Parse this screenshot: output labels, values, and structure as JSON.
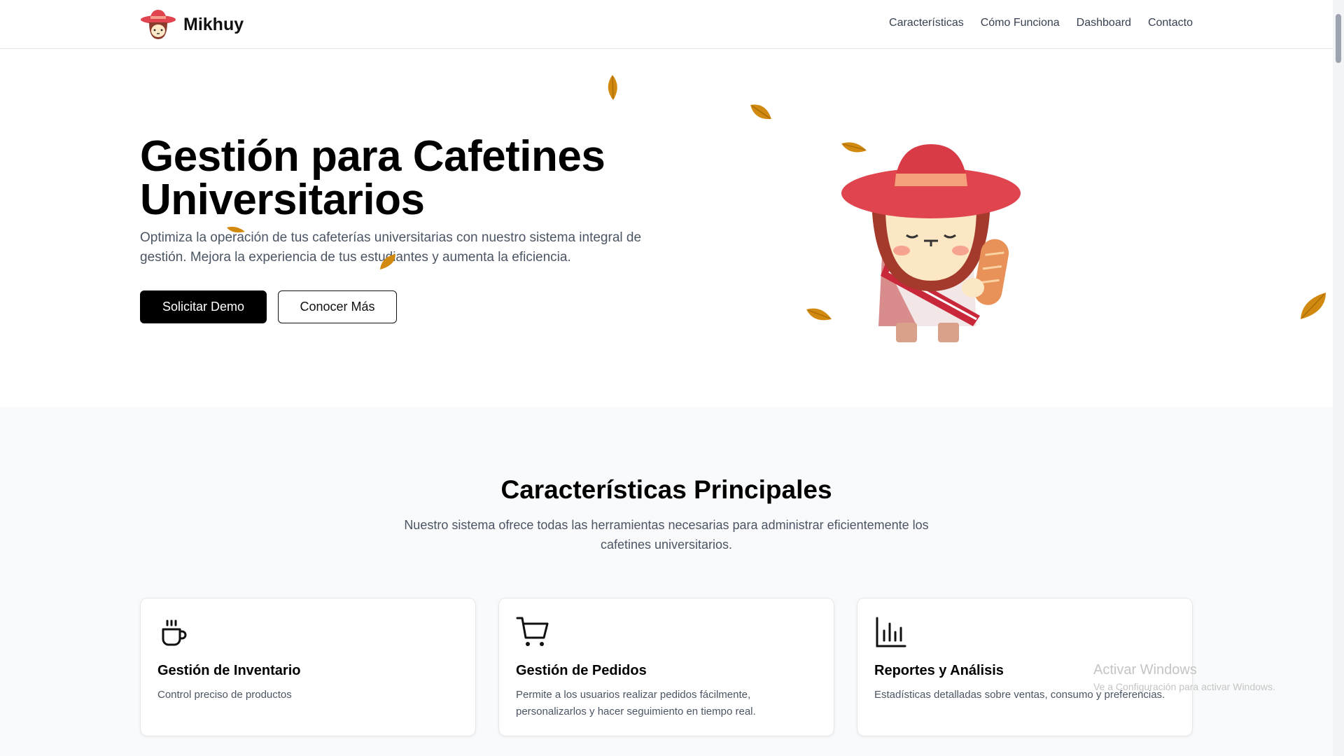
{
  "header": {
    "brand": "Mikhuy",
    "nav": [
      "Características",
      "Cómo Funciona",
      "Dashboard",
      "Contacto"
    ]
  },
  "hero": {
    "title": "Gestión para Cafetines Universitarios",
    "description": "Optimiza la operación de tus cafeterías universitarias con nuestro sistema integral de gestión. Mejora la experiencia de tus estudiantes y aumenta la eficiencia.",
    "primary_button": "Solicitar Demo",
    "secondary_button": "Conocer Más"
  },
  "features": {
    "title": "Características Principales",
    "subtitle": "Nuestro sistema ofrece todas las herramientas necesarias para administrar eficientemente los cafetines universitarios.",
    "cards": [
      {
        "icon": "coffee-cup-icon",
        "title": "Gestión de Inventario",
        "text": "Control preciso de productos"
      },
      {
        "icon": "shopping-cart-icon",
        "title": "Gestión de Pedidos",
        "text": "Permite a los usuarios realizar pedidos fácilmente, personalizarlos y hacer seguimiento en tiempo real."
      },
      {
        "icon": "bar-chart-icon",
        "title": "Reportes y Análisis",
        "text": "Estadísticas detalladas sobre ventas, consumo y preferencias."
      }
    ]
  },
  "watermark": {
    "title": "Activar Windows",
    "subtitle": "Ve a Configuración para activar Windows."
  },
  "colors": {
    "primary": "#000000",
    "leaf": "#d18a0f",
    "hat": "#e0444f",
    "section_bg": "#f9fafb"
  }
}
